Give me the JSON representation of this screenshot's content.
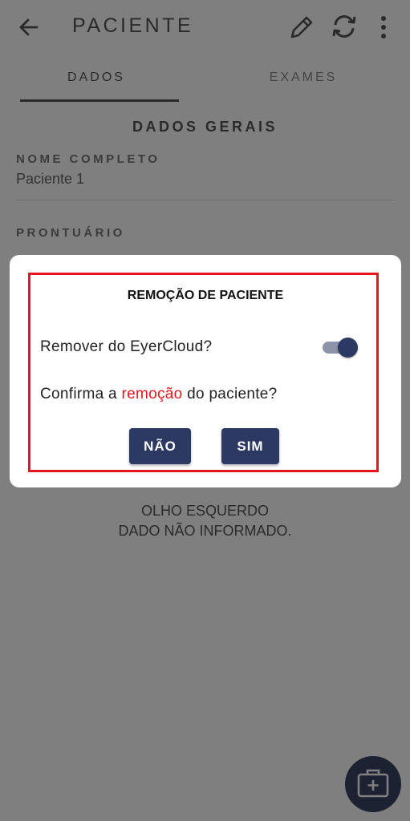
{
  "header": {
    "title": "PACIENTE"
  },
  "tabs": [
    {
      "label": "DADOS",
      "active": true
    },
    {
      "label": "EXAMES",
      "active": false
    }
  ],
  "section": {
    "title": "DADOS GERAIS"
  },
  "fields": [
    {
      "label": "NOME COMPLETO",
      "value": "Paciente 1"
    },
    {
      "label": "PRONTUÁRIO",
      "value": ""
    }
  ],
  "eye": {
    "title": "OLHO ESQUERDO",
    "value": "DADO NÃO INFORMADO."
  },
  "dialog": {
    "title": "REMOÇÃO DE PACIENTE",
    "toggle_label": "Remover do EyerCloud?",
    "toggle_on": true,
    "confirm_prefix": "Confirma a ",
    "confirm_highlight": "remoção",
    "confirm_suffix": " do paciente?",
    "no_label": "NÃO",
    "yes_label": "SIM"
  },
  "icons": {
    "back": "arrow-back-icon",
    "edit": "pencil-icon",
    "sync": "sync-icon",
    "more": "more-vert-icon",
    "fab": "medical-kit-icon"
  },
  "colors": {
    "primary": "#2c3a63",
    "highlight": "#e8141e",
    "overlay": "rgba(0,0,0,0.5)"
  }
}
